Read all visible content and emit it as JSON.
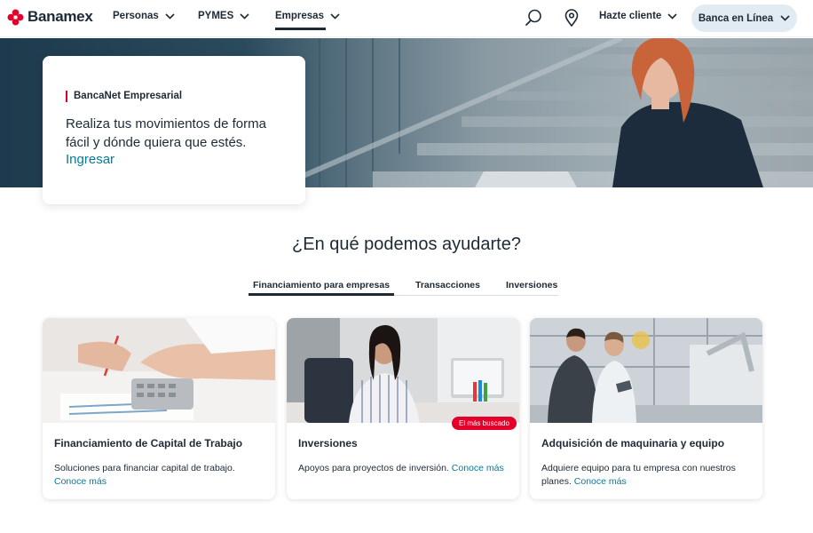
{
  "brand": {
    "name": "Banamex",
    "accent": "#e4002b",
    "link_color": "#047b9a",
    "text_color": "#1d2a36"
  },
  "nav": {
    "items": [
      {
        "label": "Personas"
      },
      {
        "label": "PYMES"
      },
      {
        "label": "Empresas",
        "active": true
      }
    ],
    "icons": [
      "search-icon",
      "location-pin-icon"
    ],
    "hazte_cliente": "Hazte cliente",
    "banca_en_linea": "Banca en Línea"
  },
  "hero": {
    "kicker": "BancaNet Empresarial",
    "text": "Realiza tus movimientos de forma fácil y dónde quiera que estés.",
    "link": "Ingresar"
  },
  "section": {
    "title": "¿En qué podemos ayudarte?",
    "tabs": [
      {
        "label": "Financiamiento para empresas",
        "active": true
      },
      {
        "label": "Transacciones"
      },
      {
        "label": "Inversiones"
      }
    ]
  },
  "cards": [
    {
      "title": "Financiamiento de Capital de Trabajo",
      "desc": "Soluciones para financiar capital de trabajo.",
      "more": "Conoce más"
    },
    {
      "title": "Inversiones",
      "desc": "Apoyos para proyectos de inversión.",
      "more": "Conoce más",
      "badge": "El más buscado"
    },
    {
      "title": "Adquisición de maquinaria y equipo",
      "desc": "Adquiere equipo para tu empresa con nuestros planes.",
      "more": "Conoce más"
    }
  ]
}
